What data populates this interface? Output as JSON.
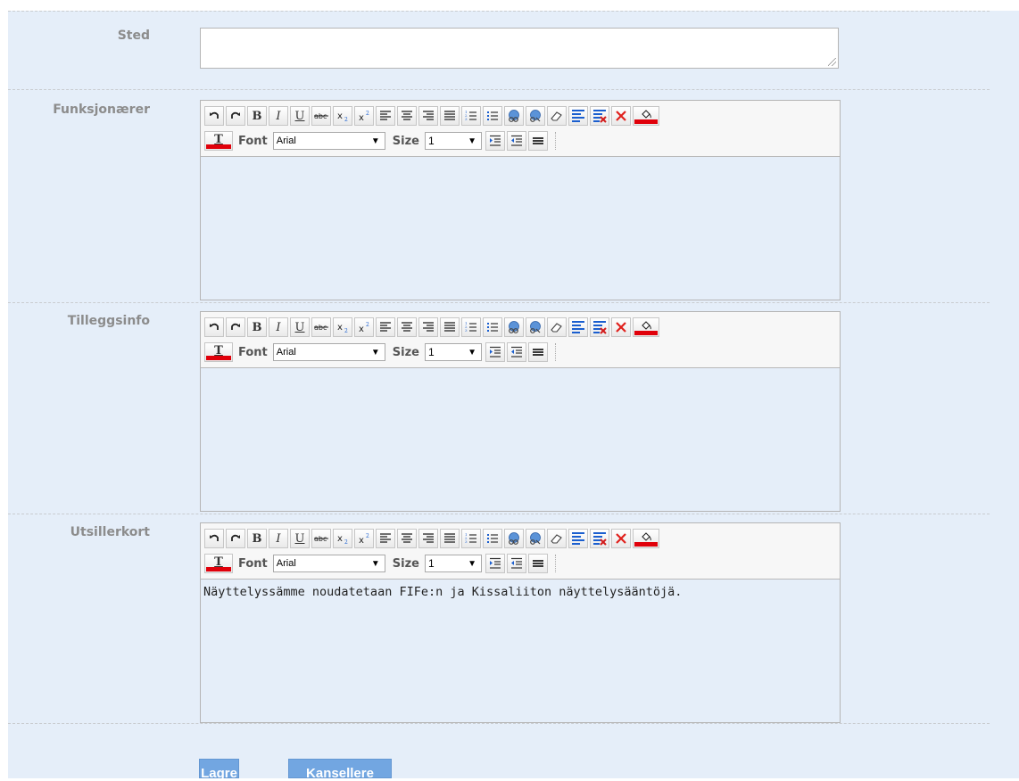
{
  "form": {
    "sted_label": "Sted",
    "sted_value": "",
    "funksjonaerer_label": "Funksjonærer",
    "tilleggsinfo_label": "Tilleggsinfo",
    "utsillerkort_label": "Utsillerkort"
  },
  "editors": [
    {
      "label": "Funksjonærer",
      "content": ""
    },
    {
      "label": "Tilleggsinfo",
      "content": ""
    },
    {
      "label": "Utsillerkort",
      "content": "Näyttelyssämme noudatetaan FIFe:n ja Kissaliiton näyttelysääntöjä."
    }
  ],
  "toolbar": {
    "font_label": "Font",
    "font_value": "Arial",
    "size_label": "Size",
    "size_value": "1",
    "bold_label": "B",
    "italic_label": "I",
    "underline_label": "U",
    "text_color_label": "T",
    "icons": [
      "undo-icon",
      "redo-icon",
      "bold-icon",
      "italic-icon",
      "underline-icon",
      "strikethrough-icon",
      "subscript-icon",
      "superscript-icon",
      "align-left-icon",
      "align-center-icon",
      "align-right-icon",
      "justify-icon",
      "ordered-list-icon",
      "unordered-list-icon",
      "link-icon",
      "unlink-icon",
      "eraser-icon",
      "format-block-icon",
      "remove-format-icon",
      "delete-icon",
      "highlight-color-icon",
      "text-color-icon",
      "indent-icon",
      "outdent-icon",
      "horizontal-rule-icon"
    ]
  },
  "actions": {
    "save_label": "Lagre",
    "cancel_label": "Kansellere"
  },
  "colors": {
    "background": "#e5eef9",
    "label": "#8c8c8c",
    "button": "#72a6e1",
    "color_swatch": "#e0000a"
  }
}
